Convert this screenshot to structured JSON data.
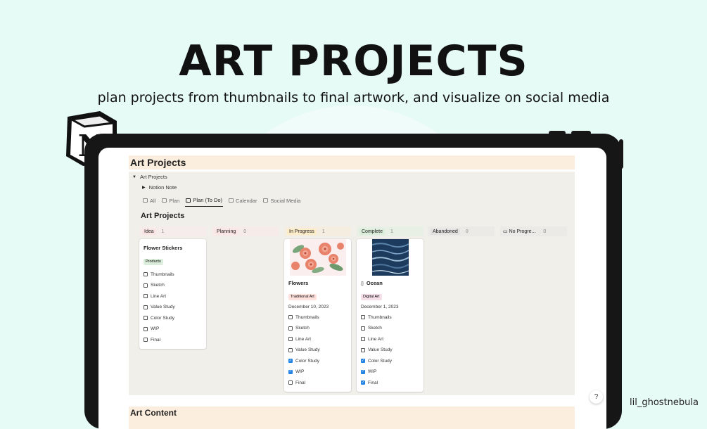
{
  "hero": {
    "title": "ART PROJECTS",
    "subtitle": "plan projects from thumbnails to final artwork, and visualize on social media"
  },
  "watermark": "lil_ghostnebula",
  "page": {
    "title": "Art Projects",
    "toggle_db": "Art Projects",
    "toggle_note": "Notion Note",
    "next_section": "Art Content"
  },
  "tabs": [
    {
      "label": "All",
      "icon": "table-icon"
    },
    {
      "label": "Plan",
      "icon": "board-icon"
    },
    {
      "label": "Plan (To Do)",
      "icon": "board-icon",
      "active": true
    },
    {
      "label": "Calendar",
      "icon": "calendar-icon"
    },
    {
      "label": "Social Media",
      "icon": "gallery-icon"
    }
  ],
  "board": {
    "title": "Art Projects",
    "columns": [
      {
        "name": "Idea",
        "count": "1",
        "color": "#fbe4e4",
        "head_bg": "#f7ecec"
      },
      {
        "name": "Planning",
        "count": "0",
        "color": "#fbe4e4",
        "head_bg": "#f6ebe8"
      },
      {
        "name": "In Progress",
        "count": "1",
        "color": "#fdecc8",
        "head_bg": "#f5ede0"
      },
      {
        "name": "Complete",
        "count": "1",
        "color": "#dbeddb",
        "head_bg": "#e8efe5"
      },
      {
        "name": "Abandoned",
        "count": "0",
        "color": "#e3e2e0",
        "head_bg": "#ebeae7"
      },
      {
        "name": "No Progre...",
        "count": "0",
        "color": "#ffffff",
        "head_bg": "#ebeae7"
      }
    ],
    "cards": {
      "flower_stickers": {
        "title": "Flower Stickers",
        "tag": "Products",
        "tag_color": "#dbeddb",
        "checklist": [
          {
            "label": "Thumbnails",
            "checked": false
          },
          {
            "label": "Sketch",
            "checked": false
          },
          {
            "label": "Line Art",
            "checked": false
          },
          {
            "label": "Value Study",
            "checked": false
          },
          {
            "label": "Color Study",
            "checked": false
          },
          {
            "label": "WIP",
            "checked": false
          },
          {
            "label": "Final",
            "checked": false
          }
        ]
      },
      "flowers": {
        "title": "Flowers",
        "tag": "Traditional Art",
        "tag_color": "#ffe2dd",
        "date": "December 10, 2023",
        "checklist": [
          {
            "label": "Thumbnails",
            "checked": false
          },
          {
            "label": "Sketch",
            "checked": false
          },
          {
            "label": "Line Art",
            "checked": false
          },
          {
            "label": "Value Study",
            "checked": false
          },
          {
            "label": "Color Study",
            "checked": true
          },
          {
            "label": "WIP",
            "checked": true
          },
          {
            "label": "Final",
            "checked": false
          }
        ]
      },
      "ocean": {
        "title": "Ocean",
        "tag": "Digital Art",
        "tag_color": "#f5e0e9",
        "date": "December 1, 2023",
        "checklist": [
          {
            "label": "Thumbnails",
            "checked": false
          },
          {
            "label": "Sketch",
            "checked": false
          },
          {
            "label": "Line Art",
            "checked": false
          },
          {
            "label": "Value Study",
            "checked": false
          },
          {
            "label": "Color Study",
            "checked": true
          },
          {
            "label": "WIP",
            "checked": true
          },
          {
            "label": "Final",
            "checked": true
          }
        ]
      }
    }
  },
  "help": "?"
}
